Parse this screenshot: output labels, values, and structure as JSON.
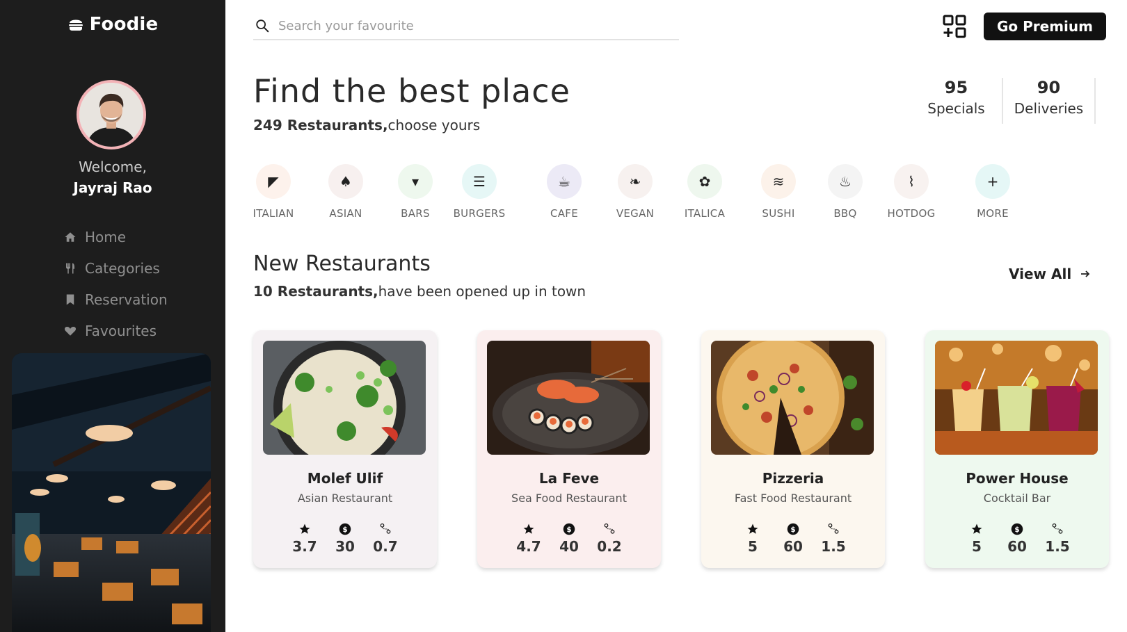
{
  "brand": {
    "name": "Foodie"
  },
  "user": {
    "welcome": "Welcome,",
    "name": "Jayraj Rao"
  },
  "nav": [
    {
      "label": "Home",
      "icon": "home-icon"
    },
    {
      "label": "Categories",
      "icon": "fork-knife-icon"
    },
    {
      "label": "Reservation",
      "icon": "bookmark-icon"
    },
    {
      "label": "Favourites",
      "icon": "heart-icon"
    }
  ],
  "search": {
    "placeholder": "Search your favourite"
  },
  "header": {
    "premium_label": "Go Premium"
  },
  "hero": {
    "title": "Find the best place",
    "count_bold": "249 Restaurants,",
    "count_rest": "choose yours"
  },
  "stats": [
    {
      "value": "95",
      "label": "Specials"
    },
    {
      "value": "90",
      "label": "Deliveries"
    }
  ],
  "categories": [
    {
      "label": "ITALIAN",
      "glyph": "◤",
      "bg": "#fdf2ec"
    },
    {
      "label": "ASIAN",
      "glyph": "♠",
      "bg": "#f7f0ef"
    },
    {
      "label": "BARS",
      "glyph": "▾",
      "bg": "#eef8ee"
    },
    {
      "label": "BURGERS",
      "glyph": "☰",
      "bg": "#e6f7f6"
    },
    {
      "label": "CAFE",
      "glyph": "☕",
      "bg": "#eceaf6"
    },
    {
      "label": "VEGAN",
      "glyph": "❧",
      "bg": "#f7f1ef"
    },
    {
      "label": "ITALICA",
      "glyph": "✿",
      "bg": "#eef7ee"
    },
    {
      "label": "SUSHI",
      "glyph": "≋",
      "bg": "#fcf2ea"
    },
    {
      "label": "BBQ",
      "glyph": "♨",
      "bg": "#f4f4f4"
    },
    {
      "label": "HOTDOG",
      "glyph": "⌇",
      "bg": "#f8f2f0"
    },
    {
      "label": "MORE",
      "glyph": "+",
      "bg": "#e5f7f6"
    }
  ],
  "new_section": {
    "title": "New Restaurants",
    "count_bold": "10 Restaurants,",
    "count_rest": "have been opened up in town",
    "view_all": "View All"
  },
  "restaurants": [
    {
      "name": "Molef Ulif",
      "type": "Asian Restaurant",
      "rating": "3.7",
      "price": "30",
      "distance": "0.7",
      "bg": "#f5f1f3"
    },
    {
      "name": "La Feve",
      "type": "Sea Food Restaurant",
      "rating": "4.7",
      "price": "40",
      "distance": "0.2",
      "bg": "#fbeeee"
    },
    {
      "name": "Pizzeria",
      "type": "Fast Food Restaurant",
      "rating": "5",
      "price": "60",
      "distance": "1.5",
      "bg": "#fcf7ef"
    },
    {
      "name": "Power House",
      "type": "Cocktail Bar",
      "rating": "5",
      "price": "60",
      "distance": "1.5",
      "bg": "#eef9ef"
    }
  ]
}
